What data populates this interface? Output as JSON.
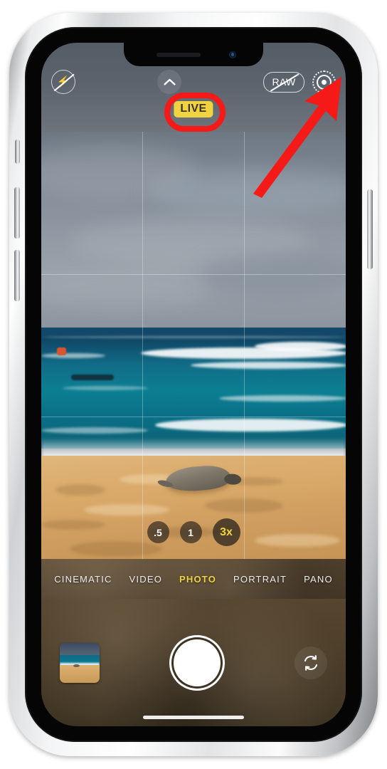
{
  "device": {
    "name": "iphone-silver",
    "notch": {
      "speaker": "earpiece-speaker",
      "camera": "front-camera"
    },
    "buttons": [
      "silent-switch",
      "volume-up",
      "volume-down",
      "power"
    ]
  },
  "app": {
    "name": "Camera",
    "top_controls": {
      "flash": {
        "label": "Flash Off",
        "icon": "flash-off-icon",
        "state": "off"
      },
      "expand": {
        "label": "More Controls",
        "icon": "chevron-up-icon"
      },
      "raw": {
        "label": "RAW",
        "icon": "raw-off-icon",
        "state": "off"
      },
      "live_photo": {
        "label": "Live Photo",
        "icon": "live-photo-icon",
        "state": "on"
      }
    },
    "live_badge": "LIVE",
    "zoom_levels": [
      {
        "label": ".5",
        "active": false
      },
      {
        "label": "1",
        "active": false
      },
      {
        "label": "3x",
        "active": true
      }
    ],
    "modes": [
      {
        "label": "CINEMATIC",
        "active": false
      },
      {
        "label": "VIDEO",
        "active": false
      },
      {
        "label": "PHOTO",
        "active": true
      },
      {
        "label": "PORTRAIT",
        "active": false
      },
      {
        "label": "PANO",
        "active": false
      }
    ],
    "bottom_controls": {
      "thumbnail": {
        "label": "Photo Library Thumbnail",
        "icon": "photo-thumbnail"
      },
      "shutter": {
        "label": "Shutter",
        "icon": "shutter-button"
      },
      "flip": {
        "label": "Switch Camera",
        "icon": "camera-flip-icon"
      }
    },
    "viewfinder": {
      "scene": "Beach with monk seal, ocean waves and overcast sky",
      "grid": "on"
    }
  },
  "annotations": {
    "ring": {
      "target": "live-badge",
      "color": "#f51a18"
    },
    "arrow": {
      "target": "live-photo-button",
      "color": "#f51a18",
      "direction": "up-right"
    }
  }
}
